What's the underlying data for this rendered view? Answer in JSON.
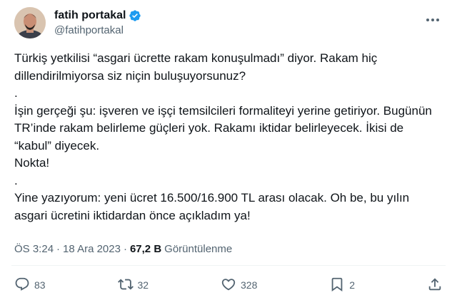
{
  "author": {
    "display_name": "fatih portakal",
    "handle": "@fatihportakal",
    "verified": true,
    "verified_color": "#1d9bf0"
  },
  "tweet": {
    "paragraphs": [
      "Türkiş yetkilisi “asgari ücrette rakam konuşulmadı” diyor. Rakam hiç dillendirilmiyorsa siz niçin buluşuyorsunuz?",
      ".",
      "İşin gerçeği şu: işveren ve işçi temsilcileri formaliteyi yerine getiriyor. Bugünün TR’inde rakam belirleme güçleri yok. Rakamı iktidar belirleyecek. İkisi de “kabul” diyecek.",
      "Nokta!",
      ".",
      "Yine yazıyorum: yeni ücret 16.500/16.900 TL arası olacak. Oh be, bu yılın asgari ücretini iktidardan önce açıkladım ya!"
    ]
  },
  "meta": {
    "time": "ÖS 3:24",
    "separator": "·",
    "date": "18 Ara 2023",
    "views_count": "67,2 B",
    "views_label": "Görüntülenme"
  },
  "actions": {
    "replies": "83",
    "reposts": "32",
    "likes": "328",
    "bookmarks": "2"
  },
  "colors": {
    "text": "#0f1419",
    "secondary": "#536471",
    "divider": "#eff3f4"
  }
}
